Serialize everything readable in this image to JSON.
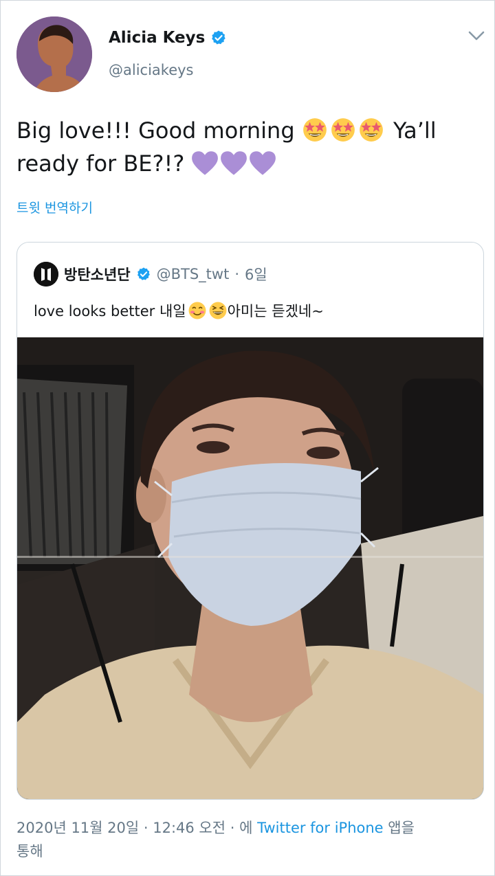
{
  "author": {
    "display_name": "Alicia Keys",
    "handle": "@aliciakeys",
    "verified": true,
    "avatar_icon": "profile-photo"
  },
  "tweet": {
    "text_part1": "Big love!!! Good morning",
    "text_part2": " Ya’ll",
    "text_part3": "ready for BE?!?",
    "translate_label": "트윗 번역하기"
  },
  "quoted": {
    "display_name": "방탄소년단",
    "handle": "@BTS_twt",
    "separator": "·",
    "age": "6일",
    "text_part1": "love looks better 내일",
    "text_part2": " 아미는 듣겠네~",
    "logo_icon": "bts-logo-icon"
  },
  "meta": {
    "date": "2020년 11월 20일",
    "dot": " · ",
    "time": "12:46 오전",
    "via_prefix": " · 에 ",
    "source": "Twitter for iPhone",
    "via_suffix": " 앱을",
    "via_suffix2": "통해"
  },
  "colors": {
    "link": "#1b95e0",
    "secondary": "#657786",
    "border": "#ccd6dd",
    "heart": "#aa8ed6",
    "verified": "#1da1f2"
  }
}
